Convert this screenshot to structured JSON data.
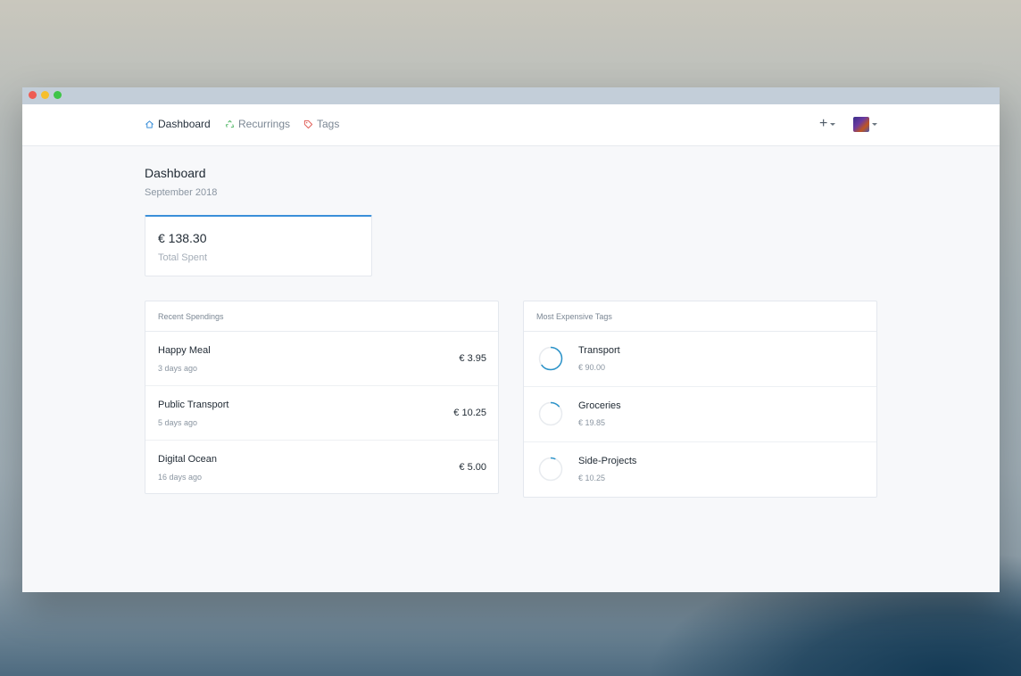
{
  "nav": {
    "items": [
      {
        "label": "Dashboard",
        "icon": "home-icon",
        "color": "#3a8fd9"
      },
      {
        "label": "Recurrings",
        "icon": "recycle-icon",
        "color": "#55b86a"
      },
      {
        "label": "Tags",
        "icon": "tag-icon",
        "color": "#e0605a"
      }
    ]
  },
  "page": {
    "title": "Dashboard",
    "subtitle": "September 2018"
  },
  "stat": {
    "value": "€ 138.30",
    "label": "Total Spent",
    "accent": "#3a8fd9"
  },
  "recent": {
    "title": "Recent Spendings",
    "rows": [
      {
        "name": "Happy Meal",
        "when": "3 days ago",
        "amount": "€ 3.95"
      },
      {
        "name": "Public Transport",
        "when": "5 days ago",
        "amount": "€ 10.25"
      },
      {
        "name": "Digital Ocean",
        "when": "16 days ago",
        "amount": "€ 5.00"
      }
    ]
  },
  "tags": {
    "title": "Most Expensive Tags",
    "rows": [
      {
        "name": "Transport",
        "amount": "€ 90.00",
        "share": 0.65
      },
      {
        "name": "Groceries",
        "amount": "€ 19.85",
        "share": 0.14
      },
      {
        "name": "Side-Projects",
        "amount": "€ 10.25",
        "share": 0.07
      }
    ]
  }
}
